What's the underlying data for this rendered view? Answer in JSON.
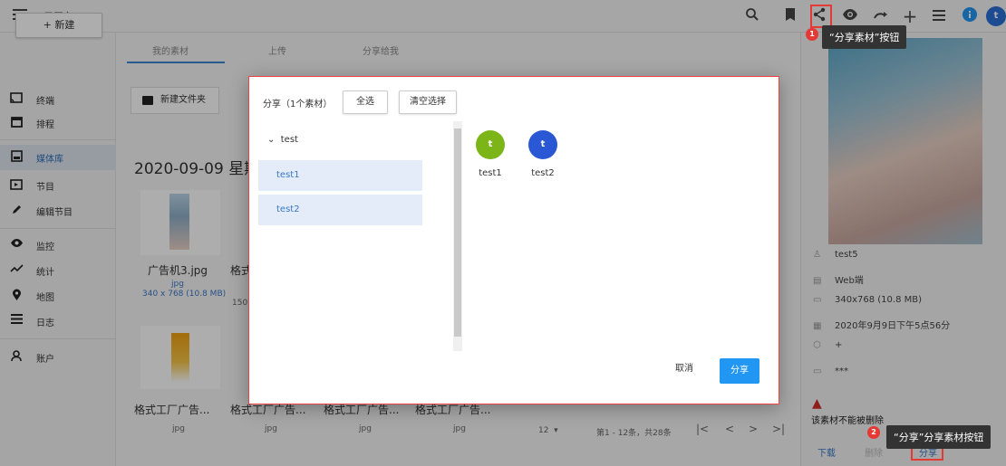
{
  "app": {
    "title": "云平台"
  },
  "topbar": {
    "icons": [
      "search-icon",
      "bookmark-icon",
      "share-icon",
      "eye-icon",
      "redo-icon",
      "plus-icon",
      "list-icon",
      "info-icon",
      "user-avatar"
    ],
    "avatar_letter": "t"
  },
  "sidebar": {
    "new_button": "+ 新建",
    "items": [
      {
        "label": "终端",
        "icon": "cast-icon"
      },
      {
        "label": "排程",
        "icon": "calendar-icon"
      },
      {
        "label": "媒体库",
        "icon": "media-icon"
      },
      {
        "label": "节目",
        "icon": "program-icon"
      },
      {
        "label": "编辑节目",
        "icon": "pencil-icon"
      },
      {
        "label": "监控",
        "icon": "eye-icon"
      },
      {
        "label": "统计",
        "icon": "chart-icon"
      },
      {
        "label": "地图",
        "icon": "map-pin-icon"
      },
      {
        "label": "日志",
        "icon": "list-icon"
      },
      {
        "label": "账户",
        "icon": "person-icon"
      }
    ]
  },
  "main": {
    "tabs": [
      "我的素材",
      "上传",
      "分享给我"
    ],
    "new_folder": "新建文件夹",
    "date_heading": "2020-09-09 星期",
    "row1": {
      "name": "广告机3.jpg",
      "type": "jpg",
      "size": "340 x 768 (10.8 MB)",
      "name2": "格式",
      "size2": "150"
    },
    "row2": [
      {
        "name": "格式工厂广告...",
        "type": "jpg"
      },
      {
        "name": "格式工厂广告...",
        "type": "jpg"
      },
      {
        "name": "格式工厂广告...",
        "type": "jpg"
      },
      {
        "name": "格式工厂广告...",
        "type": "jpg"
      }
    ],
    "pager": {
      "per_page": "12",
      "range": "第1 - 12条，共28条"
    }
  },
  "right": {
    "owner": "test5",
    "source": "Web端",
    "dimensions": "340x768 (10.8 MB)",
    "created": "2020年9月9日下午5点56分",
    "tags": "+",
    "note": "***",
    "warning": "该素材不能被删除",
    "download": "下载",
    "delete": "删除",
    "share": "分享"
  },
  "modal": {
    "title": "分享（1个素材）",
    "select_all": "全选",
    "clear": "清空选择",
    "group": "test",
    "group_items": [
      "test1",
      "test2"
    ],
    "selected": [
      {
        "letter": "t",
        "name": "test1",
        "color": "#7cb518"
      },
      {
        "letter": "t",
        "name": "test2",
        "color": "#2a57d4"
      }
    ],
    "cancel": "取消",
    "confirm": "分享"
  },
  "callouts": {
    "c1_num": "1",
    "c1_text": "“分享素材”按钮",
    "c2_num": "2",
    "c2_text": "“分享”分享素材按钮"
  }
}
